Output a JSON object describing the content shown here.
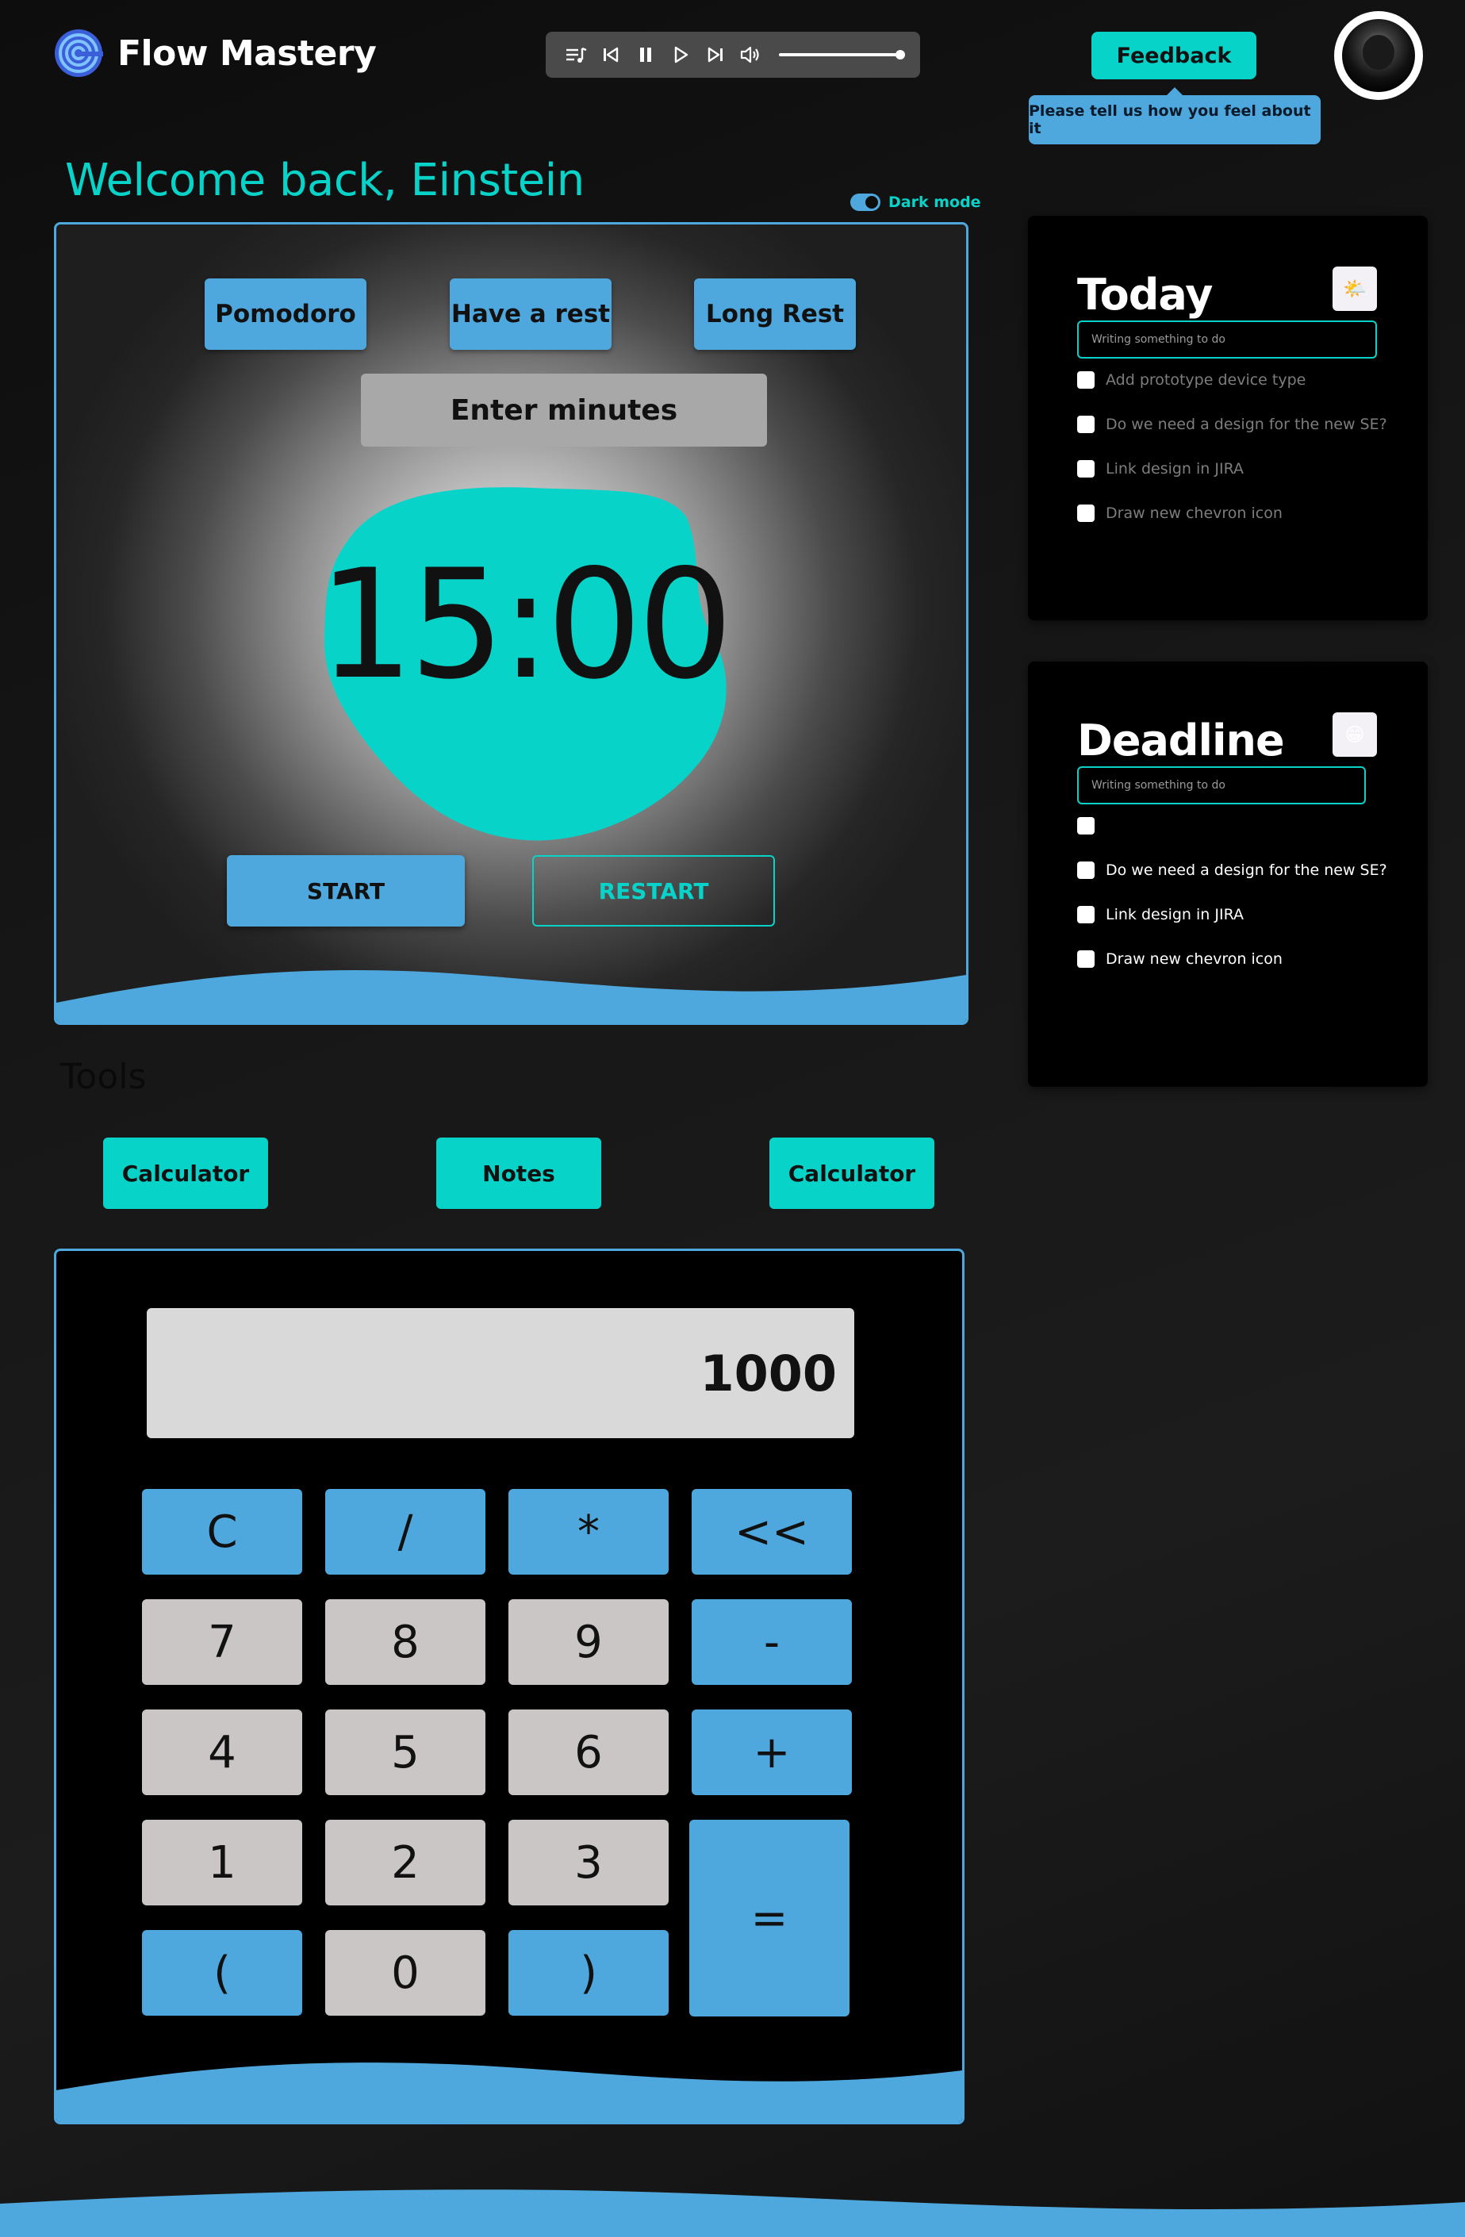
{
  "app": {
    "name": "Flow Mastery"
  },
  "header": {
    "feedback_label": "Feedback",
    "feedback_tooltip": "Please tell us how you feel about it"
  },
  "player": {
    "icons": [
      "playlist-icon",
      "previous-icon",
      "pause-icon",
      "play-icon",
      "next-icon",
      "volume-icon"
    ],
    "volume_level": 1.0
  },
  "welcome": {
    "text": "Welcome back, Einstein",
    "dark_mode_label": "Dark mode",
    "dark_mode_on": true
  },
  "timer": {
    "modes": [
      "Pomodoro",
      "Have a rest",
      "Long Rest"
    ],
    "minutes_placeholder": "Enter minutes",
    "time": "15:00",
    "start_label": "START",
    "restart_label": "RESTART"
  },
  "tools": {
    "title": "Tools",
    "buttons": [
      "Calculator",
      "Notes",
      "Calculator"
    ]
  },
  "calculator": {
    "display": "1000",
    "keys": [
      [
        "C",
        "/",
        "*",
        "<<"
      ],
      [
        "7",
        "8",
        "9",
        "-"
      ],
      [
        "4",
        "5",
        "6",
        "+"
      ],
      [
        "1",
        "2",
        "3",
        "="
      ],
      [
        "(",
        "0",
        ")"
      ]
    ]
  },
  "today": {
    "title": "Today",
    "emoji": "🌤️",
    "input_placeholder": "Writing something to do",
    "tasks": [
      "Add prototype device type",
      "Do we need a design for the new SE?",
      "Link design in JIRA",
      "Draw new chevron icon"
    ]
  },
  "deadline": {
    "title": "Deadline",
    "emoji": "😁",
    "input_placeholder": "Writing something to do",
    "tasks": [
      "",
      "Do we need a design for the new SE?",
      "Link design in JIRA",
      "Draw new chevron icon"
    ]
  },
  "colors": {
    "accent_teal": "#08d3c9",
    "accent_blue": "#4ea8de",
    "key_gray": "#cbc6c6",
    "background": "#141414"
  }
}
